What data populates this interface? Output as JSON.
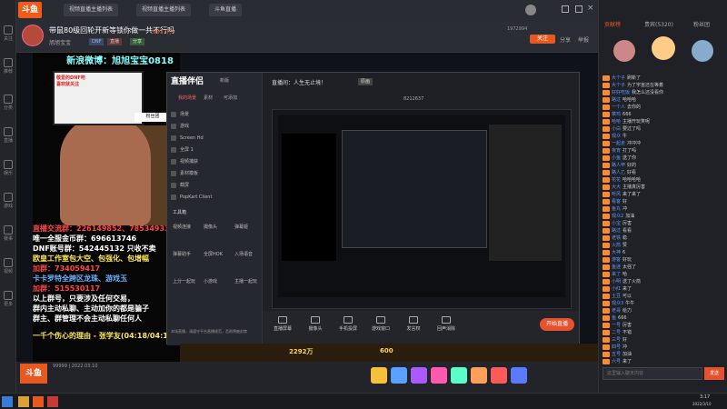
{
  "app": {
    "logo": "斗鱼",
    "nav_label": "关注"
  },
  "sidebar": {
    "items": [
      "推荐",
      "分类",
      "直播",
      "娱乐",
      "游戏",
      "赛事",
      "视频",
      "更多"
    ]
  },
  "topbar": {
    "tabs": [
      "视频直播主播列表",
      "视频直播主播列表",
      "斗鱼直播"
    ]
  },
  "header": {
    "title": "带鼠80级回轮开新等锁你做一共不行吗",
    "anchor": "旭旭宝宝",
    "tags": [
      "DNF",
      "直播",
      "分享"
    ],
    "room_id": "1972994",
    "follow_label": "关注",
    "follow_count": "9817万",
    "share_label": "分享",
    "report_label": "举报"
  },
  "video": {
    "overlay_top": "新浪微博：旭旭宝宝0818",
    "poster_caption": "敬爱的DNF吧\n喜欢就关注",
    "right_caption": "粉丝团",
    "texts": [
      {
        "t": "直播交流群：226149852、785349338",
        "c": "r"
      },
      {
        "t": "唯一全服金币群：696613746",
        "c": "w"
      },
      {
        "t": "DNF账号群：542445132 只收不卖",
        "c": "w"
      },
      {
        "t": "欧皇工作室包大空、包强化、包增幅",
        "c": "y"
      },
      {
        "t": "加群：734059417",
        "c": "r"
      },
      {
        "t": "卡卡罗特全跨区龙珠、游戏玉",
        "c": "b"
      },
      {
        "t": "加群：515530117",
        "c": "r"
      },
      {
        "t": "以上群号，只要涉及任何交易，",
        "c": "w"
      },
      {
        "t": "群内主动私聊、主动加你的都是骗子",
        "c": "w"
      },
      {
        "t": "群主、群管理不会主动私聊任何人",
        "c": "w"
      }
    ],
    "ticker": "一千个伤心的理由 - 张学友(04:18/04:19)",
    "bottom_stat": "99999 | 2022.03.10"
  },
  "companion": {
    "title": "直播伴侣",
    "version": "新版",
    "tabs": [
      "我的场景",
      "素材",
      "可添加"
    ],
    "scenes": [
      "场景",
      "游戏",
      "Screen Hd",
      "全屏 1",
      "视频捕获",
      "素材模板",
      "截屏",
      "PopKart Client"
    ],
    "tool_header": "工具箱",
    "tools": [
      [
        "视频连接",
        "摄像头",
        "弹幕姬"
      ],
      [
        "弹幕助手",
        "全屏HOK",
        "入场语音"
      ],
      [
        "上分一起玩",
        "小游戏",
        "主播一起玩"
      ]
    ],
    "info_line": "直播间：人生无止境！",
    "quality": "原画",
    "viewer_count": "8212637",
    "bottom_tools": [
      "直播屏幕",
      "摄像头",
      "手机投屏",
      "游戏窗口",
      "发言权",
      "回声消除"
    ],
    "start_label": "开始直播",
    "notice": "本场直播，请遵守平台直播规范，否则将被封禁"
  },
  "game": {
    "score1": "2292万",
    "score2": "600"
  },
  "bottom": {
    "status": "99999 | 2022.03.10"
  },
  "chat": {
    "tabs": [
      "贡献榜",
      "贵宾(5320)",
      "粉丝团"
    ],
    "lines": [
      {
        "u": "大个子",
        "m": "刷新了"
      },
      {
        "u": "大个子",
        "m": "为了宇宙还在等着"
      },
      {
        "u": "好好吃饭",
        "m": "我怎么还没看你"
      },
      {
        "u": "路过",
        "m": "哈哈哈"
      },
      {
        "u": "一个人",
        "m": "去你的"
      },
      {
        "u": "菜鸡",
        "m": "666"
      },
      {
        "u": "哈哈",
        "m": "主播开玩笑呢"
      },
      {
        "u": "小白",
        "m": "要过了吗"
      },
      {
        "u": "观众",
        "m": "牛"
      },
      {
        "u": "一起走",
        "m": "冲冲冲"
      },
      {
        "u": "夜宵",
        "m": "打了吗"
      },
      {
        "u": "小鱼",
        "m": "送了你"
      },
      {
        "u": "路人甲",
        "m": "好的"
      },
      {
        "u": "路人乙",
        "m": "好看"
      },
      {
        "u": "花花",
        "m": "哈哈哈哈"
      },
      {
        "u": "大大",
        "m": "主播真厉害"
      },
      {
        "u": "听风",
        "m": "来了来了"
      },
      {
        "u": "看客",
        "m": "好"
      },
      {
        "u": "鱼丸",
        "m": "冲"
      },
      {
        "u": "观众2",
        "m": "加油"
      },
      {
        "u": "小宝",
        "m": "厉害"
      },
      {
        "u": "路过",
        "m": "看看"
      },
      {
        "u": "老铁",
        "m": "稳"
      },
      {
        "u": "火箭",
        "m": "赞"
      },
      {
        "u": "大神",
        "m": "6"
      },
      {
        "u": "游客",
        "m": "好玩"
      },
      {
        "u": "鱼迷",
        "m": "太强了"
      },
      {
        "u": "来了",
        "m": "哈"
      },
      {
        "u": "小明",
        "m": "送了火箭"
      },
      {
        "u": "小红",
        "m": "来了"
      },
      {
        "u": "土豆",
        "m": "可以"
      },
      {
        "u": "观众3",
        "m": "牛牛"
      },
      {
        "u": "老哥",
        "m": "给力"
      },
      {
        "u": "鱼",
        "m": "666"
      },
      {
        "u": "一号",
        "m": "厉害"
      },
      {
        "u": "二号",
        "m": "不错"
      },
      {
        "u": "三号",
        "m": "好"
      },
      {
        "u": "四号",
        "m": "冲"
      },
      {
        "u": "五号",
        "m": "加油"
      },
      {
        "u": "六号",
        "m": "来了"
      },
      {
        "u": "七号",
        "m": "赞"
      }
    ],
    "input_placeholder": "这里输入聊天内容",
    "send_label": "发送"
  },
  "taskbar": {
    "time": "3:17",
    "date": "2022/3/10"
  }
}
